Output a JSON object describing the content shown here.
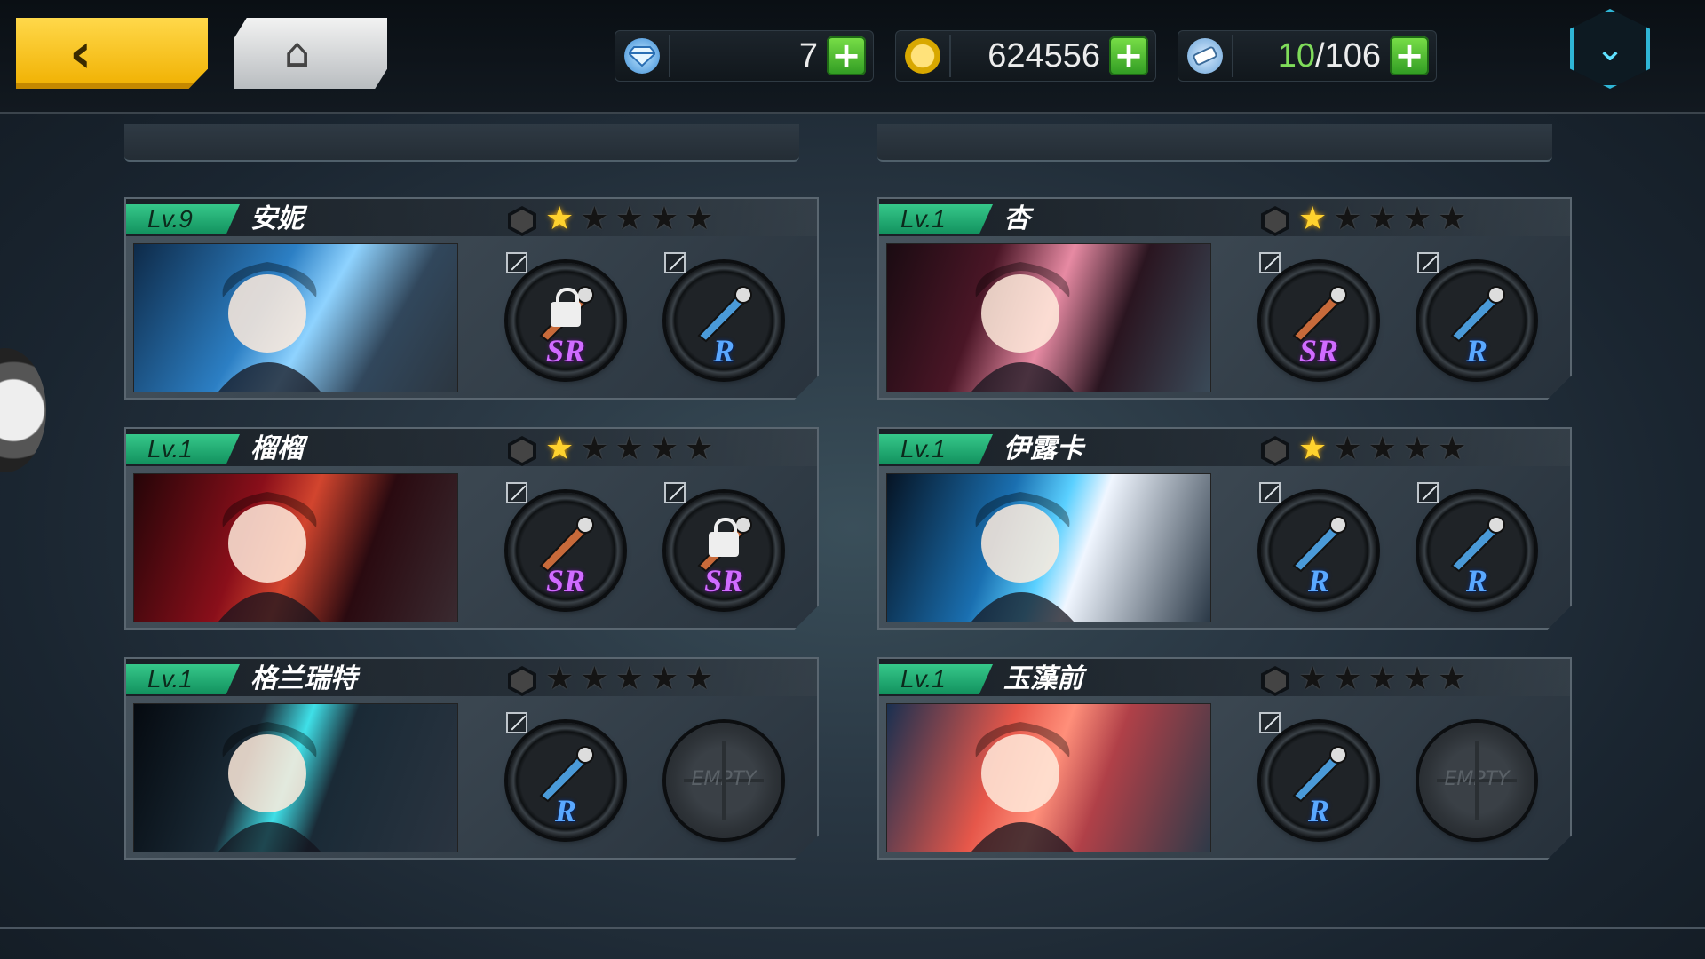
{
  "topbar": {
    "back_label": "‹",
    "home_label": "⌂",
    "gems": {
      "icon": "gem-icon",
      "value": "7"
    },
    "coins": {
      "icon": "coin-icon",
      "value": "624556"
    },
    "stamina": {
      "icon": "ticket-icon",
      "current": "10",
      "max": "/106"
    },
    "plus_label": "+"
  },
  "colors": {
    "level_badge": "#1fae6e",
    "star_on": "#ffd22e",
    "sr": "#d06cff",
    "r": "#5aa8ff",
    "plus": "#4cc234"
  },
  "characters": [
    {
      "level": "Lv.9",
      "name": "安妮",
      "stars": 1,
      "slots": [
        {
          "rarity": "SR",
          "item": "gun-icon",
          "locked": true
        },
        {
          "rarity": "R",
          "item": "paw-staff-icon",
          "locked": false
        }
      ]
    },
    {
      "level": "Lv.1",
      "name": "杏",
      "stars": 1,
      "slots": [
        {
          "rarity": "SR",
          "item": "scepter-icon",
          "locked": false
        },
        {
          "rarity": "R",
          "item": "cane-icon",
          "locked": false
        }
      ]
    },
    {
      "level": "Lv.1",
      "name": "榴榴",
      "stars": 1,
      "slots": [
        {
          "rarity": "SR",
          "item": "umbrella-icon",
          "locked": false
        },
        {
          "rarity": "SR",
          "item": "red-umbrella-icon",
          "locked": true
        }
      ]
    },
    {
      "level": "Lv.1",
      "name": "伊露卡",
      "stars": 1,
      "slots": [
        {
          "rarity": "R",
          "item": "twin-swords-icon",
          "locked": false
        },
        {
          "rarity": "R",
          "item": "crystal-blades-icon",
          "locked": false
        }
      ]
    },
    {
      "level": "Lv.1",
      "name": "格兰瑞特",
      "stars": 0,
      "slots": [
        {
          "rarity": "R",
          "item": "blade-icon",
          "locked": false
        },
        {
          "empty": true,
          "label": "EMPTY"
        }
      ]
    },
    {
      "level": "Lv.1",
      "name": "玉藻前",
      "stars": 0,
      "slots": [
        {
          "rarity": "R",
          "item": "pink-creature-icon",
          "locked": false
        },
        {
          "empty": true,
          "label": "EMPTY"
        }
      ]
    }
  ]
}
